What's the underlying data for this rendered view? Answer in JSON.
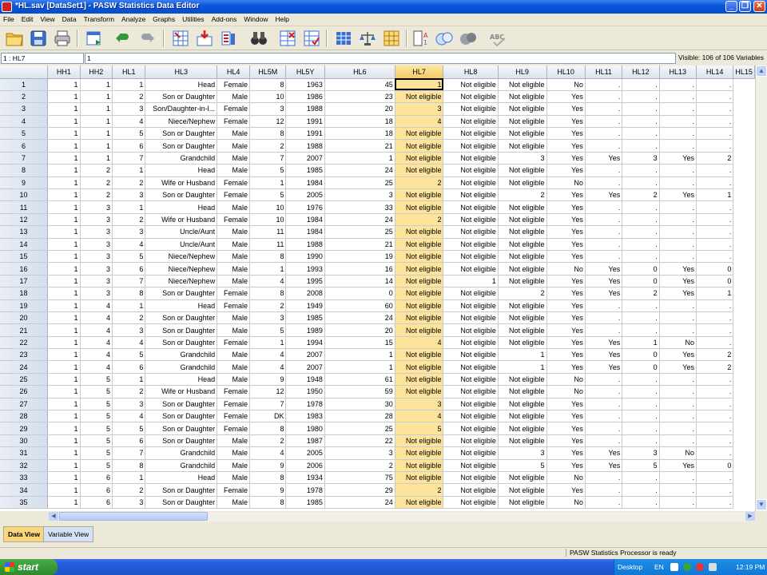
{
  "window": {
    "title": "*HL.sav [DataSet1] - PASW Statistics Data Editor"
  },
  "menu": [
    "File",
    "Edit",
    "View",
    "Data",
    "Transform",
    "Analyze",
    "Graphs",
    "Utilities",
    "Add-ons",
    "Window",
    "Help"
  ],
  "cell_editor": {
    "cell_ref": "1 : HL7",
    "value": "1",
    "visible_label": "Visible: 106 of 106 Variables"
  },
  "columns": [
    "HH1",
    "HH2",
    "HL1",
    "HL3",
    "HL4",
    "HL5M",
    "HL5Y",
    "HL6",
    "HL7",
    "HL8",
    "HL9",
    "HL10",
    "HL11",
    "HL12",
    "HL13",
    "HL14",
    "HL15"
  ],
  "rows": [
    [
      "1",
      "1",
      "1",
      "1",
      "Head",
      "Female",
      "8",
      "1963",
      "45",
      "1",
      "Not eligible",
      "Not eligible",
      "No",
      ".",
      ".",
      ".",
      "."
    ],
    [
      "2",
      "1",
      "1",
      "2",
      "Son or Daughter",
      "Male",
      "10",
      "1986",
      "23",
      "Not eligible",
      "Not eligible",
      "Not eligible",
      "Yes",
      ".",
      ".",
      ".",
      "."
    ],
    [
      "3",
      "1",
      "1",
      "3",
      "Son/Daughter-in-l...",
      "Female",
      "3",
      "1988",
      "20",
      "3",
      "Not eligible",
      "Not eligible",
      "Yes",
      ".",
      ".",
      ".",
      "."
    ],
    [
      "4",
      "1",
      "1",
      "4",
      "Niece/Nephew",
      "Female",
      "12",
      "1991",
      "18",
      "4",
      "Not eligible",
      "Not eligible",
      "Yes",
      ".",
      ".",
      ".",
      "."
    ],
    [
      "5",
      "1",
      "1",
      "5",
      "Son or Daughter",
      "Male",
      "8",
      "1991",
      "18",
      "Not eligible",
      "Not eligible",
      "Not eligible",
      "Yes",
      ".",
      ".",
      ".",
      "."
    ],
    [
      "6",
      "1",
      "1",
      "6",
      "Son or Daughter",
      "Male",
      "2",
      "1988",
      "21",
      "Not eligible",
      "Not eligible",
      "Not eligible",
      "Yes",
      ".",
      ".",
      ".",
      "."
    ],
    [
      "7",
      "1",
      "1",
      "7",
      "Grandchild",
      "Male",
      "7",
      "2007",
      "1",
      "Not eligible",
      "Not eligible",
      "3",
      "Yes",
      "Yes",
      "3",
      "Yes",
      "2"
    ],
    [
      "8",
      "1",
      "2",
      "1",
      "Head",
      "Male",
      "5",
      "1985",
      "24",
      "Not eligible",
      "Not eligible",
      "Not eligible",
      "Yes",
      ".",
      ".",
      ".",
      "."
    ],
    [
      "9",
      "1",
      "2",
      "2",
      "Wife or Husband",
      "Female",
      "1",
      "1984",
      "25",
      "2",
      "Not eligible",
      "Not eligible",
      "No",
      ".",
      ".",
      ".",
      "."
    ],
    [
      "10",
      "1",
      "2",
      "3",
      "Son or Daughter",
      "Female",
      "5",
      "2005",
      "3",
      "Not eligible",
      "Not eligible",
      "2",
      "Yes",
      "Yes",
      "2",
      "Yes",
      "1"
    ],
    [
      "11",
      "1",
      "3",
      "1",
      "Head",
      "Male",
      "10",
      "1976",
      "33",
      "Not eligible",
      "Not eligible",
      "Not eligible",
      "Yes",
      ".",
      ".",
      ".",
      "."
    ],
    [
      "12",
      "1",
      "3",
      "2",
      "Wife or Husband",
      "Female",
      "10",
      "1984",
      "24",
      "2",
      "Not eligible",
      "Not eligible",
      "Yes",
      ".",
      ".",
      ".",
      "."
    ],
    [
      "13",
      "1",
      "3",
      "3",
      "Uncle/Aunt",
      "Male",
      "11",
      "1984",
      "25",
      "Not eligible",
      "Not eligible",
      "Not eligible",
      "Yes",
      ".",
      ".",
      ".",
      "."
    ],
    [
      "14",
      "1",
      "3",
      "4",
      "Uncle/Aunt",
      "Male",
      "11",
      "1988",
      "21",
      "Not eligible",
      "Not eligible",
      "Not eligible",
      "Yes",
      ".",
      ".",
      ".",
      "."
    ],
    [
      "15",
      "1",
      "3",
      "5",
      "Niece/Nephew",
      "Male",
      "8",
      "1990",
      "19",
      "Not eligible",
      "Not eligible",
      "Not eligible",
      "Yes",
      ".",
      ".",
      ".",
      "."
    ],
    [
      "16",
      "1",
      "3",
      "6",
      "Niece/Nephew",
      "Male",
      "1",
      "1993",
      "16",
      "Not eligible",
      "Not eligible",
      "Not eligible",
      "No",
      "Yes",
      "0",
      "Yes",
      "0"
    ],
    [
      "17",
      "1",
      "3",
      "7",
      "Niece/Nephew",
      "Male",
      "4",
      "1995",
      "14",
      "Not eligible",
      "1",
      "Not eligible",
      "Yes",
      "Yes",
      "0",
      "Yes",
      "0"
    ],
    [
      "18",
      "1",
      "3",
      "8",
      "Son or Daughter",
      "Female",
      "8",
      "2008",
      "0",
      "Not eligible",
      "Not eligible",
      "2",
      "Yes",
      "Yes",
      "2",
      "Yes",
      "1"
    ],
    [
      "19",
      "1",
      "4",
      "1",
      "Head",
      "Female",
      "2",
      "1949",
      "60",
      "Not eligible",
      "Not eligible",
      "Not eligible",
      "Yes",
      ".",
      ".",
      ".",
      "."
    ],
    [
      "20",
      "1",
      "4",
      "2",
      "Son or Daughter",
      "Male",
      "3",
      "1985",
      "24",
      "Not eligible",
      "Not eligible",
      "Not eligible",
      "Yes",
      ".",
      ".",
      ".",
      "."
    ],
    [
      "21",
      "1",
      "4",
      "3",
      "Son or Daughter",
      "Male",
      "5",
      "1989",
      "20",
      "Not eligible",
      "Not eligible",
      "Not eligible",
      "Yes",
      ".",
      ".",
      ".",
      "."
    ],
    [
      "22",
      "1",
      "4",
      "4",
      "Son or Daughter",
      "Female",
      "1",
      "1994",
      "15",
      "4",
      "Not eligible",
      "Not eligible",
      "Yes",
      "Yes",
      "1",
      "No",
      "."
    ],
    [
      "23",
      "1",
      "4",
      "5",
      "Grandchild",
      "Male",
      "4",
      "2007",
      "1",
      "Not eligible",
      "Not eligible",
      "1",
      "Yes",
      "Yes",
      "0",
      "Yes",
      "2"
    ],
    [
      "24",
      "1",
      "4",
      "6",
      "Grandchild",
      "Male",
      "4",
      "2007",
      "1",
      "Not eligible",
      "Not eligible",
      "1",
      "Yes",
      "Yes",
      "0",
      "Yes",
      "2"
    ],
    [
      "25",
      "1",
      "5",
      "1",
      "Head",
      "Male",
      "9",
      "1948",
      "61",
      "Not eligible",
      "Not eligible",
      "Not eligible",
      "No",
      ".",
      ".",
      ".",
      "."
    ],
    [
      "26",
      "1",
      "5",
      "2",
      "Wife or Husband",
      "Female",
      "12",
      "1950",
      "59",
      "Not eligible",
      "Not eligible",
      "Not eligible",
      "No",
      ".",
      ".",
      ".",
      "."
    ],
    [
      "27",
      "1",
      "5",
      "3",
      "Son or Daughter",
      "Female",
      "7",
      "1978",
      "30",
      "3",
      "Not eligible",
      "Not eligible",
      "Yes",
      ".",
      ".",
      ".",
      "."
    ],
    [
      "28",
      "1",
      "5",
      "4",
      "Son or Daughter",
      "Female",
      "DK",
      "1983",
      "28",
      "4",
      "Not eligible",
      "Not eligible",
      "Yes",
      ".",
      ".",
      ".",
      "."
    ],
    [
      "29",
      "1",
      "5",
      "5",
      "Son or Daughter",
      "Female",
      "8",
      "1980",
      "25",
      "5",
      "Not eligible",
      "Not eligible",
      "Yes",
      ".",
      ".",
      ".",
      "."
    ],
    [
      "30",
      "1",
      "5",
      "6",
      "Son or Daughter",
      "Male",
      "2",
      "1987",
      "22",
      "Not eligible",
      "Not eligible",
      "Not eligible",
      "Yes",
      ".",
      ".",
      ".",
      "."
    ],
    [
      "31",
      "1",
      "5",
      "7",
      "Grandchild",
      "Male",
      "4",
      "2005",
      "3",
      "Not eligible",
      "Not eligible",
      "3",
      "Yes",
      "Yes",
      "3",
      "No",
      "."
    ],
    [
      "32",
      "1",
      "5",
      "8",
      "Grandchild",
      "Male",
      "9",
      "2006",
      "2",
      "Not eligible",
      "Not eligible",
      "5",
      "Yes",
      "Yes",
      "5",
      "Yes",
      "0"
    ],
    [
      "33",
      "1",
      "6",
      "1",
      "Head",
      "Male",
      "8",
      "1934",
      "75",
      "Not eligible",
      "Not eligible",
      "Not eligible",
      "No",
      ".",
      ".",
      ".",
      "."
    ],
    [
      "34",
      "1",
      "6",
      "2",
      "Son or Daughter",
      "Female",
      "9",
      "1978",
      "29",
      "2",
      "Not eligible",
      "Not eligible",
      "Yes",
      ".",
      ".",
      ".",
      "."
    ],
    [
      "35",
      "1",
      "6",
      "3",
      "Son or Daughter",
      "Male",
      "8",
      "1985",
      "24",
      "Not eligible",
      "Not eligible",
      "Not eligible",
      "No",
      ".",
      ".",
      ".",
      "."
    ]
  ],
  "view_tabs": {
    "data_view": "Data View",
    "variable_view": "Variable View"
  },
  "status": {
    "processor": "PASW Statistics Processor is ready"
  },
  "taskbar": {
    "start": "start",
    "desktop": "Desktop",
    "lang": "EN",
    "clock": "12:19 PM"
  },
  "colors": {
    "selected_column": "#fde49a",
    "title_bar": "#0a58d8",
    "start_button": "#3a9a3a"
  }
}
